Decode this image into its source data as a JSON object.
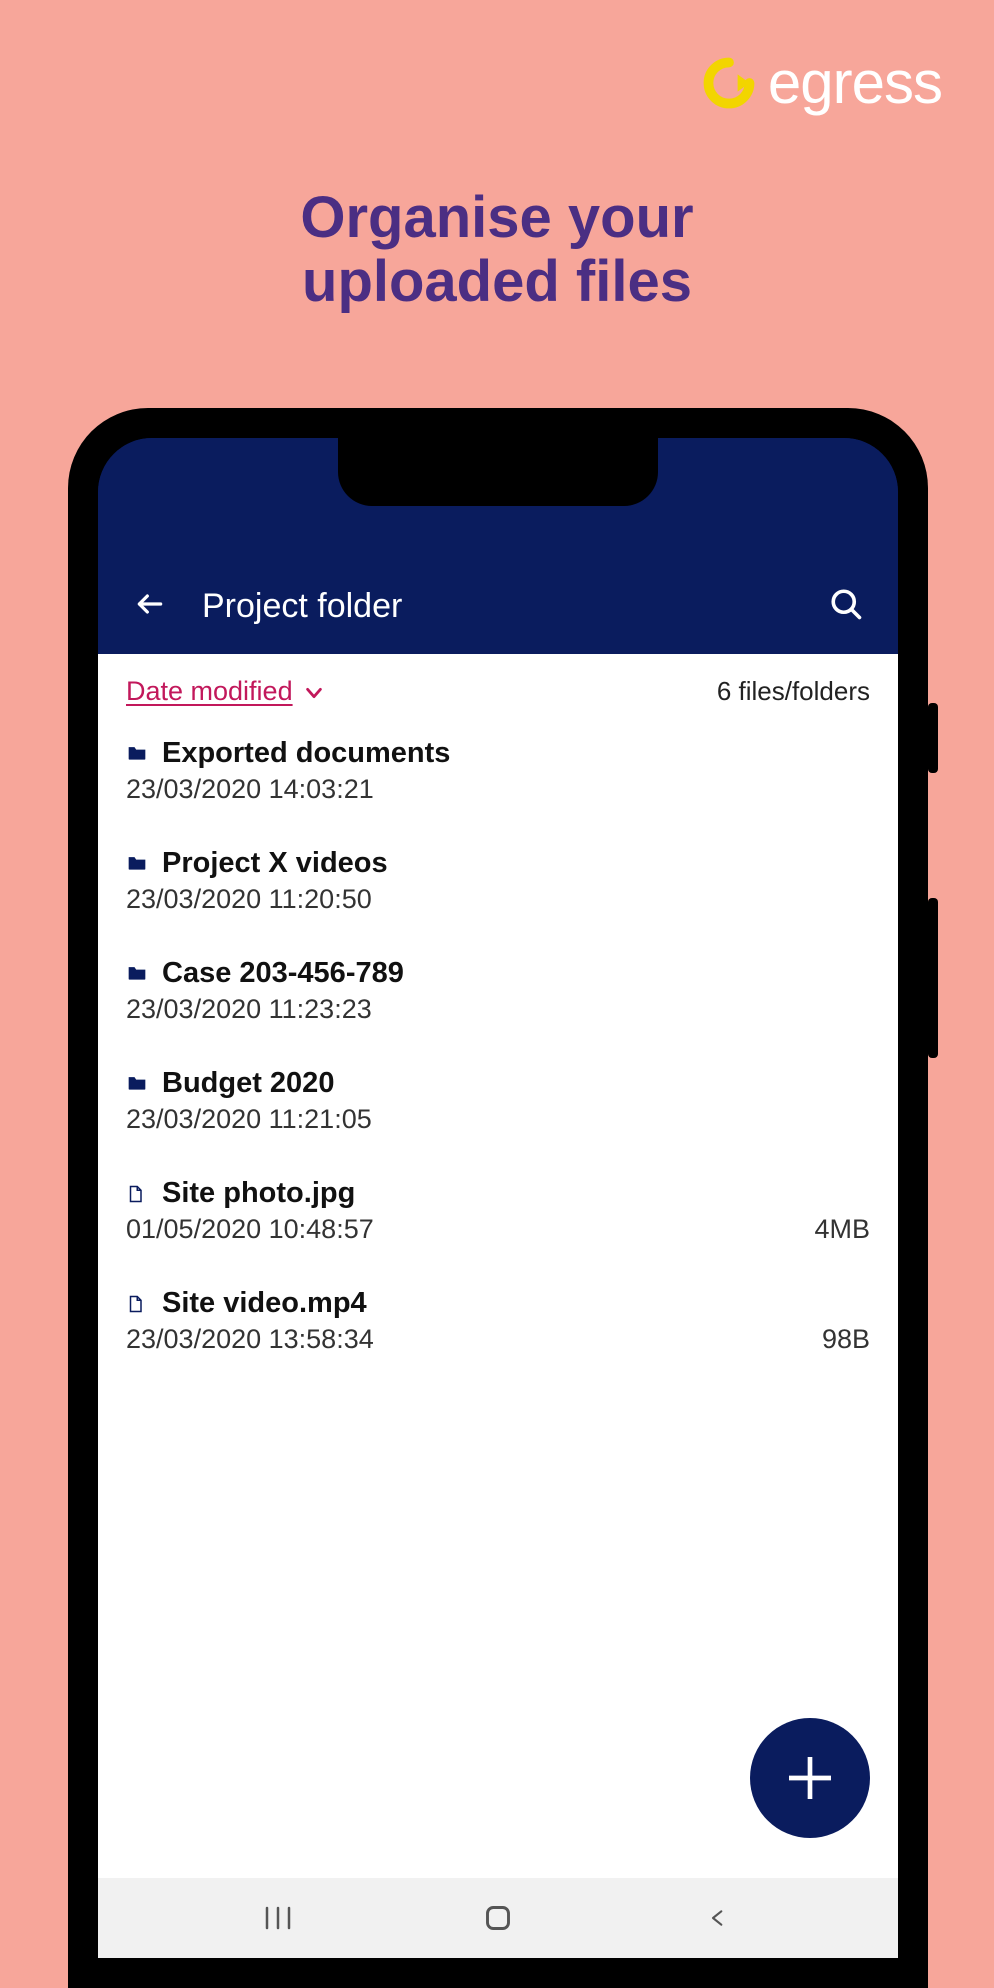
{
  "brand": {
    "name": "egress"
  },
  "headline_line1": "Organise your",
  "headline_line2": "uploaded files",
  "appbar": {
    "title": "Project folder"
  },
  "sort": {
    "label": "Date modified",
    "count": "6 files/folders"
  },
  "items": [
    {
      "type": "folder",
      "name": "Exported documents",
      "date": "23/03/2020 14:03:21",
      "size": ""
    },
    {
      "type": "folder",
      "name": "Project X videos",
      "date": "23/03/2020 11:20:50",
      "size": ""
    },
    {
      "type": "folder",
      "name": "Case 203-456-789",
      "date": "23/03/2020 11:23:23",
      "size": ""
    },
    {
      "type": "folder",
      "name": "Budget 2020",
      "date": "23/03/2020 11:21:05",
      "size": ""
    },
    {
      "type": "file",
      "name": "Site photo.jpg",
      "date": "01/05/2020 10:48:57",
      "size": "4MB"
    },
    {
      "type": "file",
      "name": "Site video.mp4",
      "date": "23/03/2020 13:58:34",
      "size": "98B"
    }
  ]
}
